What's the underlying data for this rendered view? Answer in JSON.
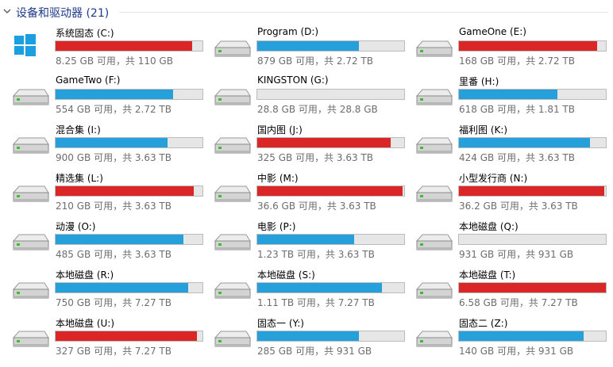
{
  "group": {
    "title": "设备和驱动器 (21)",
    "icon": "chevron-down-icon"
  },
  "colors": {
    "bar_normal": "#26a0da",
    "bar_low": "#da2626",
    "bar_track": "#e6e6e6"
  },
  "drives": [
    {
      "name": "系统固态 (C:)",
      "space": "8.25 GB 可用，共 110 GB",
      "used_fraction": 0.93,
      "low": true,
      "icon": "windows-logo-icon"
    },
    {
      "name": "Program (D:)",
      "space": "879 GB 可用，共 2.72 TB",
      "used_fraction": 0.69,
      "low": false,
      "icon": "hard-drive-icon"
    },
    {
      "name": "GameOne (E:)",
      "space": "168 GB 可用，共 2.72 TB",
      "used_fraction": 0.94,
      "low": true,
      "icon": "hard-drive-icon"
    },
    {
      "name": "GameTwo (F:)",
      "space": "554 GB 可用，共 2.72 TB",
      "used_fraction": 0.8,
      "low": false,
      "icon": "hard-drive-icon"
    },
    {
      "name": "KINGSTON (G:)",
      "space": "28.8 GB 可用，共 28.8 GB",
      "used_fraction": 0.0,
      "low": false,
      "icon": "hard-drive-icon"
    },
    {
      "name": "里番 (H:)",
      "space": "618 GB 可用，共 1.81 TB",
      "used_fraction": 0.67,
      "low": false,
      "icon": "hard-drive-icon"
    },
    {
      "name": "混合集 (I:)",
      "space": "900 GB 可用，共 3.63 TB",
      "used_fraction": 0.76,
      "low": false,
      "icon": "hard-drive-icon"
    },
    {
      "name": "国内图 (J:)",
      "space": "325 GB 可用，共 3.63 TB",
      "used_fraction": 0.91,
      "low": true,
      "icon": "hard-drive-icon"
    },
    {
      "name": "福利图 (K:)",
      "space": "424 GB 可用，共 3.63 TB",
      "used_fraction": 0.89,
      "low": false,
      "icon": "hard-drive-icon"
    },
    {
      "name": "精选集 (L:)",
      "space": "210 GB 可用，共 3.63 TB",
      "used_fraction": 0.94,
      "low": true,
      "icon": "hard-drive-icon"
    },
    {
      "name": "中影 (M:)",
      "space": "36.6 GB 可用，共 3.63 TB",
      "used_fraction": 0.99,
      "low": true,
      "icon": "hard-drive-icon"
    },
    {
      "name": "小型发行商 (N:)",
      "space": "36.2 GB 可用，共 3.63 TB",
      "used_fraction": 0.99,
      "low": true,
      "icon": "hard-drive-icon"
    },
    {
      "name": "动漫 (O:)",
      "space": "485 GB 可用，共 3.63 TB",
      "used_fraction": 0.87,
      "low": false,
      "icon": "hard-drive-icon"
    },
    {
      "name": "电影 (P:)",
      "space": "1.23 TB 可用，共 3.63 TB",
      "used_fraction": 0.66,
      "low": false,
      "icon": "hard-drive-icon"
    },
    {
      "name": "本地磁盘 (Q:)",
      "space": "931 GB 可用，共 931 GB",
      "used_fraction": 0.0,
      "low": false,
      "icon": "hard-drive-icon"
    },
    {
      "name": "本地磁盘 (R:)",
      "space": "750 GB 可用，共 7.27 TB",
      "used_fraction": 0.9,
      "low": false,
      "icon": "hard-drive-icon"
    },
    {
      "name": "本地磁盘 (S:)",
      "space": "1.11 TB 可用，共 7.27 TB",
      "used_fraction": 0.85,
      "low": false,
      "icon": "hard-drive-icon"
    },
    {
      "name": "本地磁盘 (T:)",
      "space": "6.58 GB 可用，共 7.27 TB",
      "used_fraction": 1.0,
      "low": true,
      "icon": "hard-drive-icon"
    },
    {
      "name": "本地磁盘 (U:)",
      "space": "327 GB 可用，共 7.27 TB",
      "used_fraction": 0.96,
      "low": true,
      "icon": "hard-drive-icon"
    },
    {
      "name": "固态一 (Y:)",
      "space": "285 GB 可用，共 931 GB",
      "used_fraction": 0.69,
      "low": false,
      "icon": "hard-drive-icon"
    },
    {
      "name": "固态二 (Z:)",
      "space": "140 GB 可用，共 931 GB",
      "used_fraction": 0.85,
      "low": false,
      "icon": "hard-drive-icon"
    }
  ]
}
